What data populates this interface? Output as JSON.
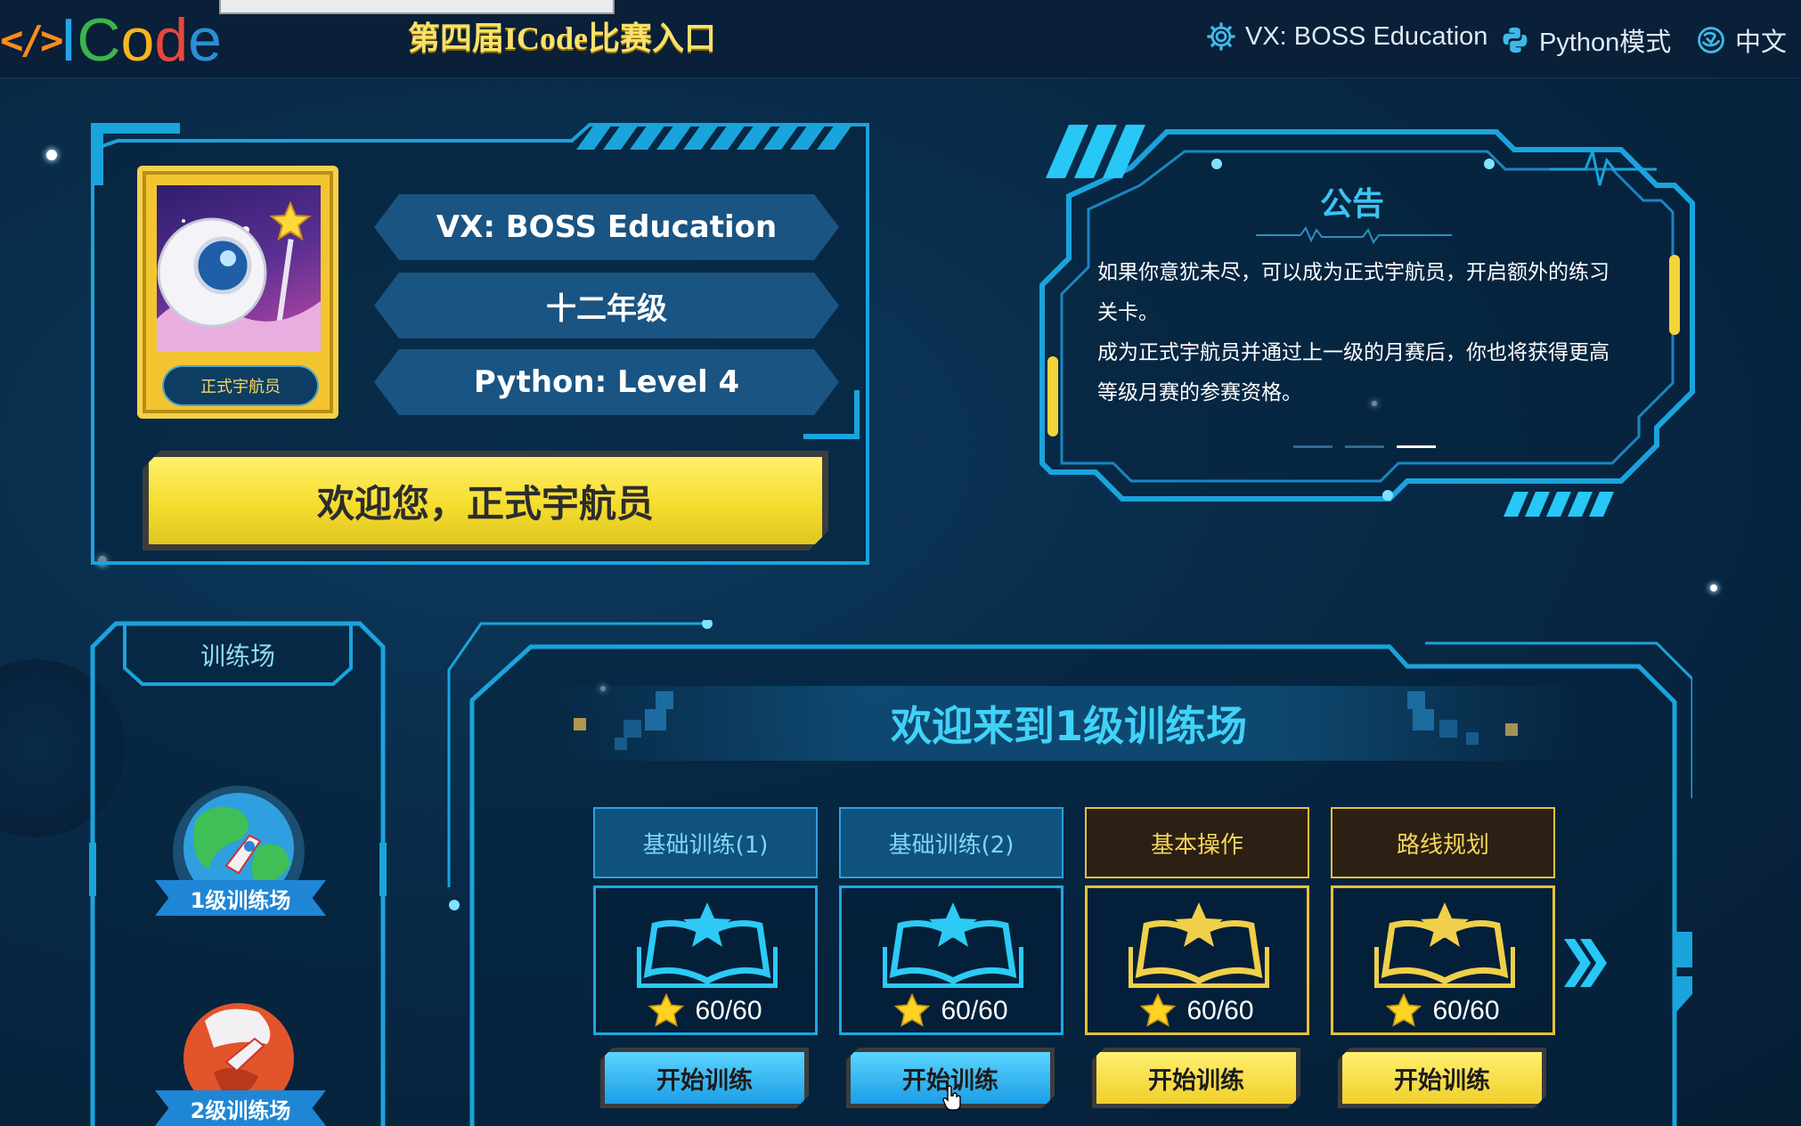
{
  "header": {
    "logo_glyph": "</>",
    "logo_letters": [
      "I",
      "C",
      "o",
      "d",
      "e"
    ],
    "contest_link": "第四届ICode比赛入口",
    "nav": [
      {
        "label": "VX: BOSS Education",
        "icon": "gear-icon"
      },
      {
        "label": "Python模式",
        "icon": "python-icon"
      },
      {
        "label": "中文",
        "icon": "language-icon"
      }
    ]
  },
  "profile": {
    "badge": "正式宇航员",
    "name": "VX: BOSS Education",
    "grade": "十二年级",
    "level": "Python: Level 4",
    "welcome": "欢迎您，正式宇航员"
  },
  "notice": {
    "title": "公告",
    "paragraphs": [
      "如果你意犹未尽，可以成为正式宇航员，开启额外的练习关卡。",
      "成为正式宇航员并通过上一级的月赛后，你也将获得更高等级月赛的参赛资格。"
    ],
    "dots": 3,
    "active_dot": 3
  },
  "sidebar": {
    "title": "训练场",
    "items": [
      {
        "label": "1级训练场"
      },
      {
        "label": "2级训练场"
      }
    ]
  },
  "main": {
    "title": "欢迎来到1级训练场",
    "courses": [
      {
        "title": "基础训练(1)",
        "score": "60/60",
        "button": "开始训练",
        "theme": "blue"
      },
      {
        "title": "基础训练(2)",
        "score": "60/60",
        "button": "开始训练",
        "theme": "blue"
      },
      {
        "title": "基本操作",
        "score": "60/60",
        "button": "开始训练",
        "theme": "gold"
      },
      {
        "title": "路线规划",
        "score": "60/60",
        "button": "开始训练",
        "theme": "gold"
      }
    ],
    "next_icon": "double-chevron-right-icon"
  },
  "colors": {
    "background": "#082a47",
    "accent_cyan": "#41d2f7",
    "accent_gold": "#f5d459",
    "button_yellow": "#f5dd2f",
    "button_blue": "#1d9ee6"
  }
}
